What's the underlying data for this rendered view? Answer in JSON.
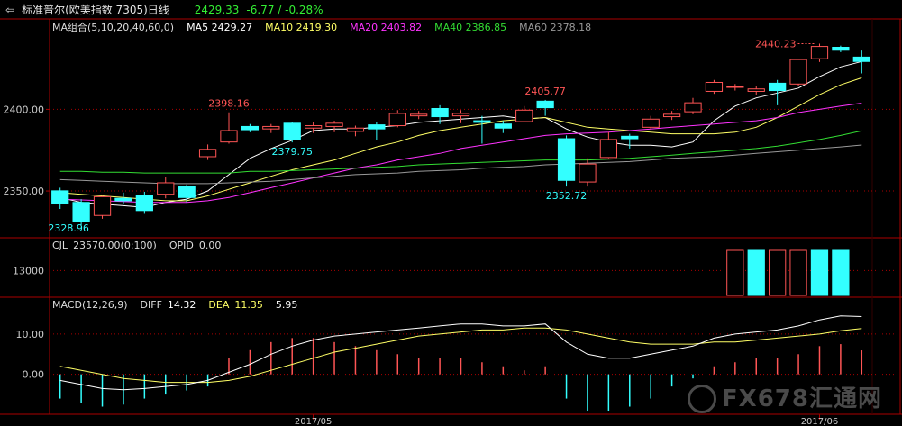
{
  "header": {
    "back_icon": "back-arrow-icon",
    "name": "标准普尔(欧美指数 7305)日线",
    "price": "2429.33",
    "change": "-6.77 / -0.28%"
  },
  "indicators": {
    "ma": {
      "label": "MA组合(5,10,20,40,60,0)",
      "items": [
        {
          "text": "MA5 2429.27",
          "color": "#ffffff"
        },
        {
          "text": "MA10 2419.30",
          "color": "#ffff66"
        },
        {
          "text": "MA20 2403.82",
          "color": "#ff33ff"
        },
        {
          "text": "MA40 2386.85",
          "color": "#33dd33"
        },
        {
          "text": "MA60 2378.18",
          "color": "#999999"
        }
      ]
    },
    "cjl": {
      "label": "CJL",
      "value": "23570.00(0:100)",
      "opid_label": "OPID",
      "opid_value": "0.00"
    },
    "macd": {
      "label": "MACD(12,26,9)",
      "diff_label": "DIFF",
      "diff_value": "14.32",
      "dea_label": "DEA",
      "dea_value": "11.35",
      "macd_value": "5.95"
    }
  },
  "watermark": "FX678汇通网",
  "colors": {
    "up": "#ff5555",
    "down": "#33ffff",
    "axis": "#aa0000",
    "grid": "#aa0000"
  },
  "chart_data": [
    {
      "type": "candlestick",
      "ylim": [
        2323,
        2446
      ],
      "yticks": [
        2350.0,
        2400.0
      ],
      "ytick_labels": [
        "2350.00",
        "2400.00"
      ],
      "xtick_labels": [
        "2017/05",
        "2017/06"
      ],
      "xtick_index": [
        12,
        36
      ],
      "candles": [
        {
          "o": 2350.1,
          "h": 2352.0,
          "l": 2339.0,
          "c": 2342.3
        },
        {
          "o": 2343.0,
          "h": 2345.0,
          "l": 2328.96,
          "c": 2331.0
        },
        {
          "o": 2335.0,
          "h": 2347.0,
          "l": 2333.0,
          "c": 2346.5
        },
        {
          "o": 2345.5,
          "h": 2349.0,
          "l": 2342.0,
          "c": 2344.0
        },
        {
          "o": 2347.0,
          "h": 2349.5,
          "l": 2336.0,
          "c": 2338.0
        },
        {
          "o": 2348.0,
          "h": 2358.5,
          "l": 2345.5,
          "c": 2355.0
        },
        {
          "o": 2353.0,
          "h": 2354.0,
          "l": 2343.0,
          "c": 2346.0
        },
        {
          "o": 2371.0,
          "h": 2378.5,
          "l": 2369.0,
          "c": 2375.5
        },
        {
          "o": 2380.0,
          "h": 2398.16,
          "l": 2379.0,
          "c": 2387.0
        },
        {
          "o": 2389.5,
          "h": 2391.0,
          "l": 2386.0,
          "c": 2387.5
        },
        {
          "o": 2388.0,
          "h": 2391.0,
          "l": 2385.5,
          "c": 2389.5
        },
        {
          "o": 2391.5,
          "h": 2392.5,
          "l": 2379.75,
          "c": 2381.5
        },
        {
          "o": 2388.5,
          "h": 2392.0,
          "l": 2385.5,
          "c": 2390.0
        },
        {
          "o": 2389.5,
          "h": 2393.0,
          "l": 2386.0,
          "c": 2391.5
        },
        {
          "o": 2386.5,
          "h": 2390.0,
          "l": 2383.5,
          "c": 2388.5
        },
        {
          "o": 2390.5,
          "h": 2392.5,
          "l": 2381.0,
          "c": 2388.0
        },
        {
          "o": 2390.0,
          "h": 2399.5,
          "l": 2389.0,
          "c": 2397.5
        },
        {
          "o": 2396.0,
          "h": 2399.0,
          "l": 2394.0,
          "c": 2397.0
        },
        {
          "o": 2400.5,
          "h": 2402.5,
          "l": 2391.0,
          "c": 2395.5
        },
        {
          "o": 2396.0,
          "h": 2399.5,
          "l": 2391.5,
          "c": 2397.5
        },
        {
          "o": 2393.0,
          "h": 2396.0,
          "l": 2379.0,
          "c": 2392.0
        },
        {
          "o": 2391.0,
          "h": 2393.0,
          "l": 2385.5,
          "c": 2388.5
        },
        {
          "o": 2392.5,
          "h": 2402.0,
          "l": 2392.0,
          "c": 2399.5
        },
        {
          "o": 2405.0,
          "h": 2405.77,
          "l": 2396.0,
          "c": 2401.0
        },
        {
          "o": 2382.0,
          "h": 2384.0,
          "l": 2352.72,
          "c": 2356.5
        },
        {
          "o": 2355.5,
          "h": 2370.0,
          "l": 2352.72,
          "c": 2366.5
        },
        {
          "o": 2370.5,
          "h": 2386.0,
          "l": 2370.0,
          "c": 2381.5
        },
        {
          "o": 2383.5,
          "h": 2385.0,
          "l": 2376.0,
          "c": 2382.0
        },
        {
          "o": 2389.0,
          "h": 2396.0,
          "l": 2388.0,
          "c": 2394.0
        },
        {
          "o": 2395.5,
          "h": 2399.0,
          "l": 2393.5,
          "c": 2397.0
        },
        {
          "o": 2398.5,
          "h": 2407.0,
          "l": 2397.0,
          "c": 2404.0
        },
        {
          "o": 2411.0,
          "h": 2418.0,
          "l": 2409.5,
          "c": 2416.5
        },
        {
          "o": 2413.5,
          "h": 2415.5,
          "l": 2411.5,
          "c": 2414.0
        },
        {
          "o": 2411.0,
          "h": 2414.0,
          "l": 2409.0,
          "c": 2412.5
        },
        {
          "o": 2416.0,
          "h": 2418.0,
          "l": 2402.5,
          "c": 2411.5
        },
        {
          "o": 2415.5,
          "h": 2431.0,
          "l": 2414.0,
          "c": 2430.5
        },
        {
          "o": 2431.0,
          "h": 2440.23,
          "l": 2429.0,
          "c": 2438.5
        },
        {
          "o": 2438.0,
          "h": 2439.0,
          "l": 2435.0,
          "c": 2436.2
        },
        {
          "o": 2432.0,
          "h": 2436.0,
          "l": 2422.0,
          "c": 2429.3
        }
      ],
      "annotations": [
        {
          "index": 8,
          "value": 2398.16,
          "text": "2398.16",
          "color": "#ff5555",
          "pos": "above"
        },
        {
          "index": 11,
          "value": 2379.75,
          "text": "2379.75",
          "color": "#33ffff",
          "pos": "below"
        },
        {
          "index": 23,
          "value": 2405.77,
          "text": "2405.77",
          "color": "#ff5555",
          "pos": "above"
        },
        {
          "index": 24,
          "value": 2352.72,
          "text": "2352.72",
          "color": "#33ffff",
          "pos": "below"
        },
        {
          "index": 36,
          "value": 2440.23,
          "text": "2440.23",
          "color": "#ff5555",
          "pos": "left-arrow"
        },
        {
          "index": 1,
          "value": 2328.96,
          "text": "2328.96",
          "color": "#33ffff",
          "pos": "lowest"
        }
      ],
      "ma_lines": [
        {
          "name": "MA5",
          "color": "#ffffff",
          "values": [
            2346,
            2343,
            2342,
            2341,
            2340,
            2343,
            2345,
            2350,
            2360,
            2370,
            2376,
            2381,
            2387,
            2388,
            2388,
            2389,
            2390,
            2392,
            2393,
            2394,
            2395,
            2396,
            2394,
            2395,
            2388,
            2383,
            2380,
            2378,
            2378,
            2377,
            2380,
            2393,
            2402,
            2407,
            2410,
            2413,
            2420,
            2426,
            2429.27
          ]
        },
        {
          "name": "MA10",
          "color": "#ffff66",
          "values": [
            2349,
            2348,
            2347,
            2346,
            2345,
            2344,
            2344,
            2347,
            2351,
            2355,
            2359,
            2363,
            2366,
            2369,
            2373,
            2377,
            2380,
            2384,
            2387,
            2389,
            2391,
            2393,
            2394,
            2395,
            2392,
            2389,
            2388,
            2387,
            2386,
            2385,
            2385,
            2385,
            2386,
            2389,
            2395,
            2402,
            2409,
            2415,
            2419.3
          ]
        },
        {
          "name": "MA20",
          "color": "#ff33ff",
          "values": [
            2345,
            2344.5,
            2344,
            2343.5,
            2343,
            2343,
            2343,
            2344,
            2346,
            2349,
            2352,
            2355,
            2358,
            2361,
            2364,
            2366,
            2369,
            2371,
            2373,
            2376,
            2378,
            2380,
            2382,
            2384,
            2385,
            2385.5,
            2386,
            2387,
            2388,
            2389,
            2390,
            2391,
            2392,
            2393,
            2395,
            2398,
            2400,
            2402,
            2403.82
          ]
        },
        {
          "name": "MA40",
          "color": "#33dd33",
          "values": [
            2362,
            2362,
            2361.5,
            2361.5,
            2361,
            2361,
            2361,
            2361,
            2361,
            2362,
            2362,
            2362.5,
            2363,
            2363.5,
            2364,
            2364.5,
            2365,
            2366,
            2366.5,
            2367,
            2367.5,
            2368,
            2368.5,
            2369,
            2369,
            2369,
            2369.5,
            2370,
            2371,
            2372,
            2373,
            2374,
            2375,
            2376,
            2377.5,
            2379.5,
            2381.5,
            2384,
            2386.85
          ]
        },
        {
          "name": "MA60",
          "color": "#999999",
          "values": [
            2357,
            2356.5,
            2356,
            2355.5,
            2355,
            2354.5,
            2354.5,
            2354.5,
            2355,
            2355.5,
            2356,
            2357,
            2358,
            2359,
            2360,
            2360.5,
            2361,
            2362,
            2362.5,
            2363,
            2364,
            2364.5,
            2365,
            2366,
            2366.5,
            2367,
            2367.5,
            2368,
            2369,
            2370,
            2370.5,
            2371,
            2372,
            2373,
            2374,
            2375,
            2376,
            2377,
            2378.18
          ]
        }
      ]
    },
    {
      "type": "bar",
      "name": "CJL",
      "ylim": [
        0,
        23570
      ],
      "yticks": [
        13000
      ],
      "ytick_labels": [
        "13000"
      ],
      "bars": [
        {
          "index": 32,
          "value": 23570,
          "dir": "up"
        },
        {
          "index": 33,
          "value": 23570,
          "dir": "down"
        },
        {
          "index": 34,
          "value": 23570,
          "dir": "up"
        },
        {
          "index": 35,
          "value": 23570,
          "dir": "up"
        },
        {
          "index": 36,
          "value": 23570,
          "dir": "down"
        },
        {
          "index": 37,
          "value": 23570,
          "dir": "down"
        }
      ]
    },
    {
      "type": "macd",
      "ylim": [
        -9,
        16
      ],
      "yticks": [
        0.0,
        10.0
      ],
      "ytick_labels": [
        "0.00",
        "10.00"
      ],
      "diff": [
        -1.5,
        -2.5,
        -3.5,
        -3.8,
        -3.5,
        -3,
        -2.5,
        -1.5,
        0.5,
        2.5,
        5,
        7,
        8.5,
        9.5,
        10,
        10.5,
        11,
        11.5,
        12,
        12.5,
        12.5,
        12,
        12,
        12.5,
        8,
        5,
        4,
        4,
        5,
        6,
        7,
        9,
        10,
        10.5,
        11,
        12,
        13.5,
        14.5,
        14.32
      ],
      "dea": [
        2,
        1,
        0,
        -1,
        -1.5,
        -2,
        -2,
        -2,
        -1.5,
        -0.5,
        1,
        2.5,
        4,
        5.5,
        6.5,
        7.5,
        8.5,
        9.5,
        10,
        10.5,
        11,
        11,
        11.5,
        11.5,
        11,
        10,
        9,
        8,
        7.5,
        7.5,
        7.5,
        8,
        8,
        8.5,
        9,
        9.5,
        10,
        10.8,
        11.35
      ],
      "macd_hist": [
        -6,
        -7,
        -8,
        -7.5,
        -6,
        -5,
        -4,
        -3,
        4,
        6,
        8,
        9,
        9,
        8,
        7,
        6,
        5,
        4,
        4,
        4,
        3,
        2,
        1,
        2,
        -6,
        -9,
        -9,
        -8,
        -6,
        -3,
        -1,
        2,
        3,
        4,
        4,
        5,
        7,
        7.5,
        5.95
      ]
    }
  ]
}
